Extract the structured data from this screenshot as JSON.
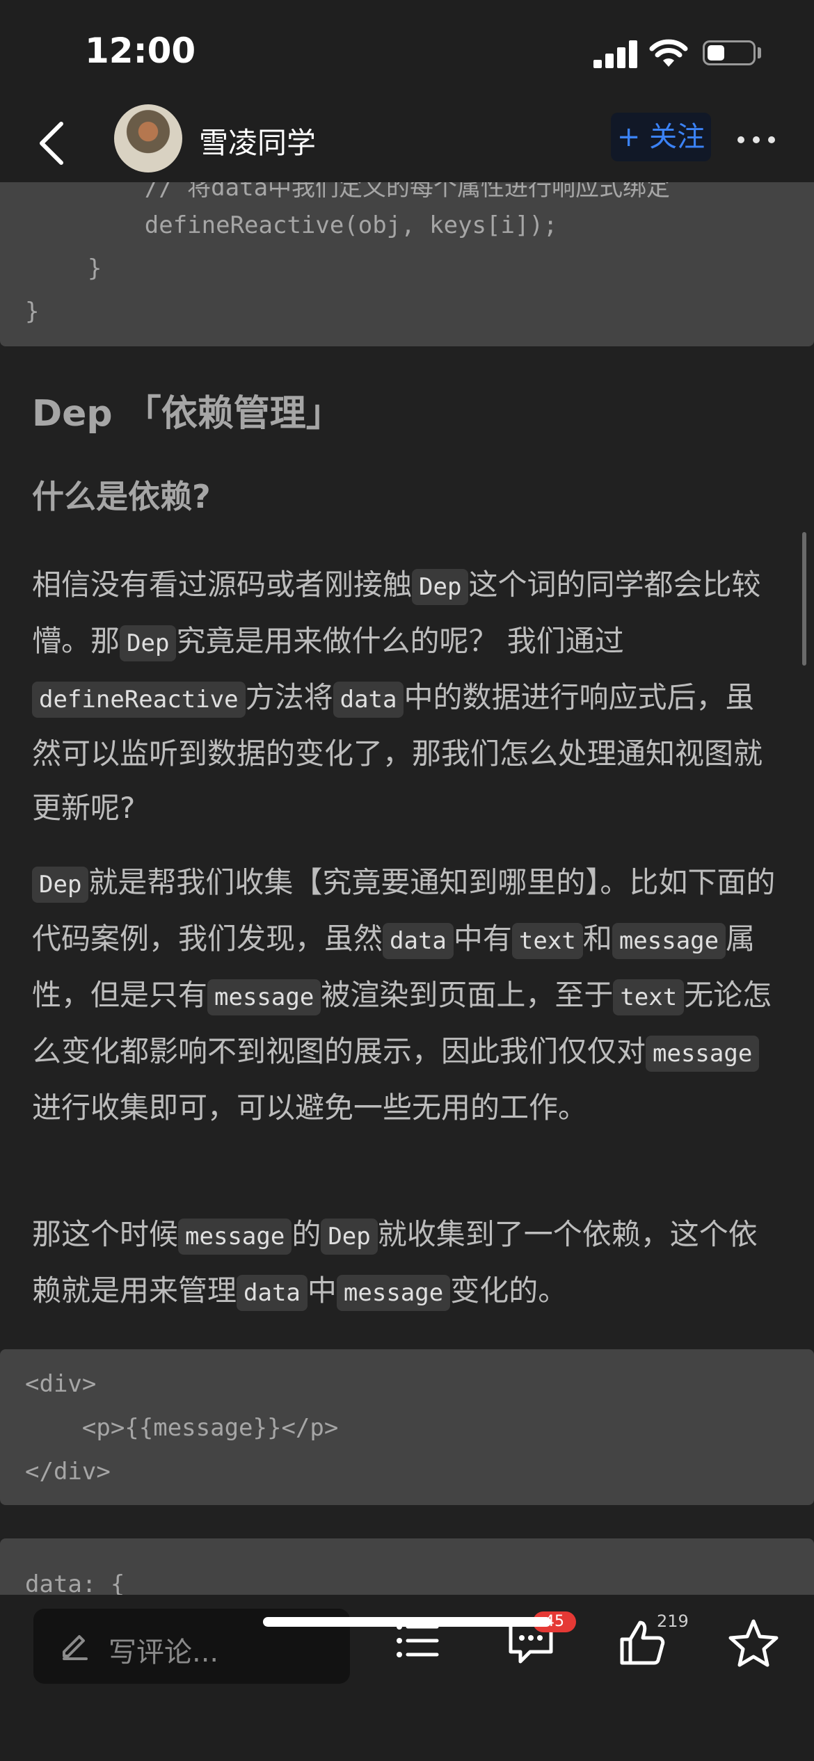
{
  "status": {
    "time": "12:00"
  },
  "header": {
    "author": "雪凌同学",
    "follow_label": "+ 关注"
  },
  "code_block_top": {
    "lines": [
      "        // 将data中我们定义的每个属性进行响应式绑定",
      "        defineReactive(obj, keys[i]);",
      "    }",
      "}"
    ]
  },
  "article": {
    "heading": "Dep 「依赖管理」",
    "subheading": "什么是依赖?",
    "p1": [
      {
        "t": "相信没有看过源码或者刚接触"
      },
      {
        "c": "Dep"
      },
      {
        "t": "这个词的同学都会比较懵。那"
      },
      {
        "c": "Dep"
      },
      {
        "t": "究竟是用来做什么的呢？ 我们通过"
      },
      {
        "c": "defineReactive"
      },
      {
        "t": "方法将"
      },
      {
        "c": "data"
      },
      {
        "t": "中的数据进行响应式后，虽然可以监听到数据的变化了，那我们怎么处理通知视图就更新呢?"
      }
    ],
    "p2": [
      {
        "c": "Dep"
      },
      {
        "t": "就是帮我们收集【究竟要通知到哪里的】。比如下面的代码案例，我们发现，虽然"
      },
      {
        "c": "data"
      },
      {
        "t": "中有"
      },
      {
        "c": "text"
      },
      {
        "t": "和"
      },
      {
        "c": "message"
      },
      {
        "t": "属性，但是只有"
      },
      {
        "c": "message"
      },
      {
        "t": "被渲染到页面上，至于"
      },
      {
        "c": "text"
      },
      {
        "t": "无论怎么变化都影响不到视图的展示，因此我们仅仅对"
      },
      {
        "c": "message"
      },
      {
        "t": "进行收集即可，可以避免一些无用的工作。"
      }
    ],
    "p3": [
      {
        "t": "那这个时候"
      },
      {
        "c": "message"
      },
      {
        "t": "的"
      },
      {
        "c": "Dep"
      },
      {
        "t": "就收集到了一个依赖，这个依赖就是用来管理"
      },
      {
        "c": "data"
      },
      {
        "t": "中"
      },
      {
        "c": "message"
      },
      {
        "t": "变化的。"
      }
    ]
  },
  "code_block_mid": {
    "lines": [
      "<div>",
      "    <p>{{message}}</p>",
      "</div>"
    ]
  },
  "code_block_bottom": {
    "lines": [
      "data: {"
    ]
  },
  "bottom_bar": {
    "comment_placeholder": "写评论...",
    "comment_count": "45",
    "like_count": "219"
  }
}
